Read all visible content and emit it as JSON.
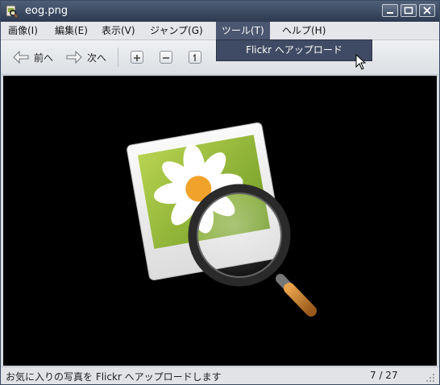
{
  "window": {
    "title": "eog.png"
  },
  "menubar": {
    "items": [
      "画像(I)",
      "編集(E)",
      "表示(V)",
      "ジャンプ(G)",
      "ツール(T)",
      "ヘルプ(H)"
    ]
  },
  "toolbar": {
    "prev_label": "前へ",
    "next_label": "次へ"
  },
  "tools_menu": {
    "items": [
      "Flickr へアップロード"
    ]
  },
  "statusbar": {
    "text": "お気に入りの写真を Flickr へアップロードします",
    "page_count": "7 / 27"
  },
  "colors": {
    "title_bar": "#3e4c64",
    "menu_highlight": "#4b5670",
    "viewer_bg": "#000000"
  }
}
